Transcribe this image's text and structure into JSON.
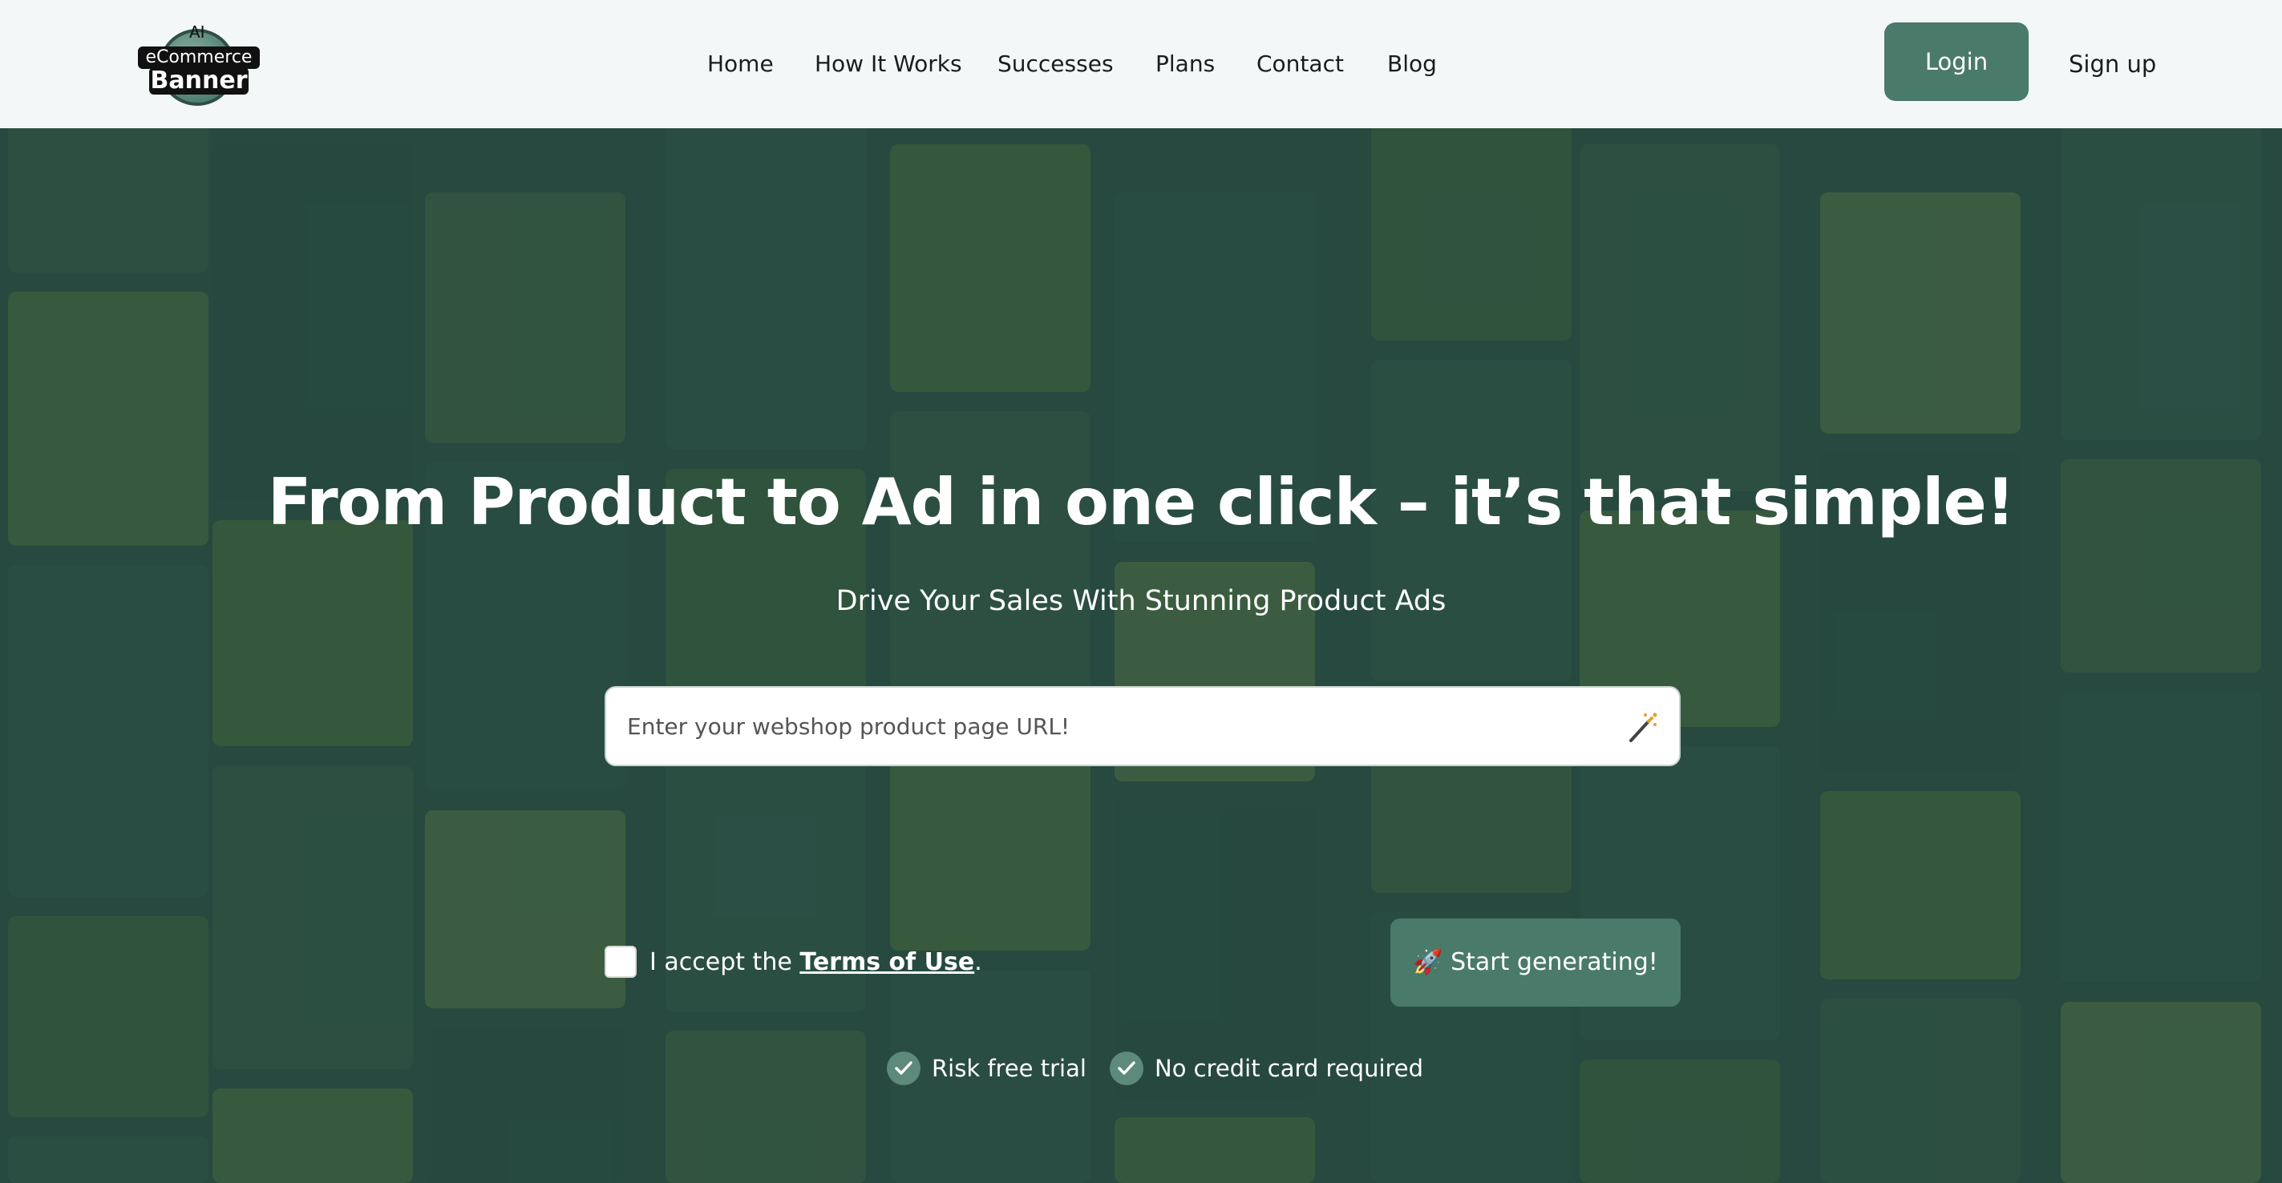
{
  "logo": {
    "ai": "AI",
    "line1": "eCommerce",
    "line2": "Banner"
  },
  "nav": {
    "items": [
      "Home",
      "How It Works",
      "Successes",
      "Plans",
      "Contact",
      "Blog"
    ],
    "login": "Login",
    "signup": "Sign up"
  },
  "hero": {
    "headline": "From Product to Ad in one click – it’s that simple!",
    "subhead": "Drive Your Sales With Stunning Product Ads",
    "url_placeholder": "Enter your webshop product page URL!",
    "terms_prefix": "I accept the",
    "terms_link": "Terms of Use",
    "terms_suffix": ".",
    "start_button": "🚀 Start generating!",
    "features": [
      "Risk free trial",
      "No credit card required"
    ]
  },
  "colors": {
    "accent": "#4a7a6a",
    "header_bg": "#f3f7f7",
    "hero_overlay": "#26483e"
  },
  "icons": {
    "wand": "magic-wand-icon",
    "check": "check-circle-icon"
  }
}
